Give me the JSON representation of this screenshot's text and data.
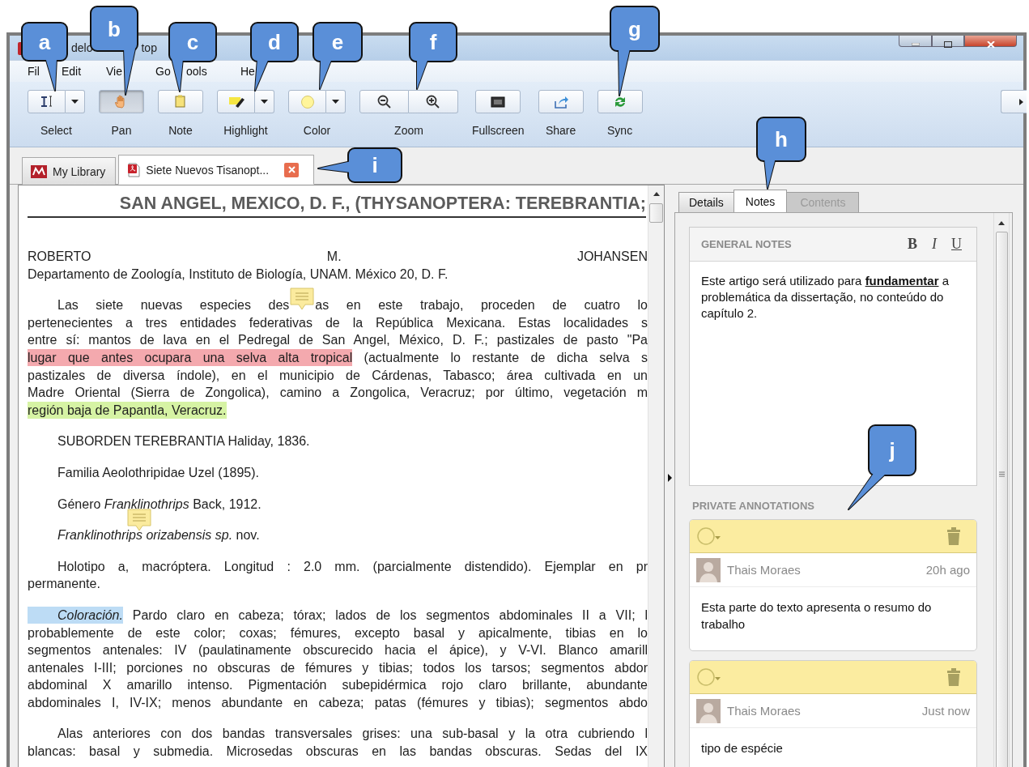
{
  "window": {
    "title_parts": [
      "delo",
      "top"
    ]
  },
  "menu": [
    "Fil",
    "Edit",
    "Vie",
    "Go",
    "ools",
    "He"
  ],
  "toolbar": [
    {
      "kind": "tool",
      "label": "Select",
      "selected": false,
      "dropdown": true
    },
    {
      "kind": "tool",
      "label": "Pan",
      "selected": true,
      "dropdown": false
    },
    {
      "kind": "tool",
      "label": "Note",
      "selected": false,
      "dropdown": false
    },
    {
      "kind": "tool",
      "label": "Highlight",
      "selected": false,
      "dropdown": true
    },
    {
      "kind": "tool",
      "label": "Color",
      "selected": false,
      "dropdown": true
    },
    {
      "kind": "pair",
      "label": "Zoom",
      "selected": false,
      "dropdown": false
    },
    {
      "kind": "tool",
      "label": "Fullscreen",
      "selected": false,
      "dropdown": false
    },
    {
      "kind": "tool",
      "label": "Share",
      "selected": false,
      "dropdown": false
    },
    {
      "kind": "tool",
      "label": "Sync",
      "selected": false,
      "dropdown": false
    }
  ],
  "doc_tabs": [
    {
      "kind": "library",
      "label": "My Library",
      "selected": false,
      "closable": false
    },
    {
      "kind": "pdf",
      "label": "Siete Nuevos Tisanopt...",
      "selected": true,
      "closable": true
    }
  ],
  "document": {
    "heading": "SAN ANGEL, MEXICO, D. F., (THYSANOPTERA: TEREBRANTIA;",
    "paragraphs": [
      {
        "indent": false,
        "continues": false,
        "lines": [
          [
            {
              "kind": "text",
              "text": "ROBERTO M. JOHANSEN"
            }
          ],
          [
            {
              "kind": "text",
              "text": "Departamento de Zoología, Instituto de Biología, UNAM. México 20, D. F."
            }
          ]
        ]
      },
      {
        "indent": true,
        "continues": false,
        "lines": [
          [
            {
              "kind": "text",
              "text": "Las siete nuevas especies des"
            },
            {
              "kind": "note"
            },
            {
              "kind": "text",
              "text": "as en este trabajo, proceden de cuatro lo"
            }
          ],
          [
            {
              "kind": "text",
              "text": "pertenecientes a tres entidades federativas de la República Mexicana. Estas localidades s"
            }
          ],
          [
            {
              "kind": "text",
              "text": "entre sí: mantos de lava en el Pedregal de San Angel, México, D. F.; pastizales de pasto \"Pa"
            }
          ],
          [
            {
              "kind": "text",
              "text": "lugar que antes ocupara una selva alta tropical",
              "color": "#f4a9ae"
            },
            {
              "kind": "text",
              "text": " (actualmente lo restante de dicha selva s"
            }
          ],
          [
            {
              "kind": "text",
              "text": "pastizales de diversa índole), en el municipio de Cárdenas, Tabasco; área cultivada en un"
            }
          ],
          [
            {
              "kind": "text",
              "text": "Madre Oriental (Sierra de Zongolica), camino a Zongolica, Veracruz; por último, vegetación m"
            }
          ],
          [
            {
              "kind": "text",
              "text": "región baja de Papantla, Veracruz.",
              "color": "#d6f3a4"
            }
          ]
        ]
      },
      {
        "indent": true,
        "continues": false,
        "lines": [
          [
            {
              "kind": "text",
              "text": "SUBORDEN TEREBRANTIA Haliday, 1836."
            }
          ]
        ]
      },
      {
        "indent": true,
        "continues": false,
        "lines": [
          [
            {
              "kind": "text",
              "text": "Familia Aeolothripidae Uzel (1895)."
            }
          ]
        ]
      },
      {
        "indent": true,
        "continues": false,
        "lines": [
          [
            {
              "kind": "text",
              "text": "Género *Franklinothrips*"
            },
            {
              "kind": "hanging_note"
            },
            {
              "kind": "text",
              "text": " Back, 1912."
            }
          ]
        ]
      },
      {
        "indent": true,
        "continues": false,
        "lines": [
          [
            {
              "kind": "text",
              "text": "*Franklinothrips orizabensis sp.* nov."
            }
          ]
        ]
      },
      {
        "indent": true,
        "continues": false,
        "lines": [
          [
            {
              "kind": "text",
              "text": "Holotipo a, macróptera. Longitud : 2.0 mm. (parcialmente distendido). Ejemplar en pr"
            }
          ],
          [
            {
              "kind": "text",
              "text": "permanente."
            }
          ]
        ]
      },
      {
        "indent": true,
        "continues": true,
        "lines": [
          [
            {
              "kind": "text",
              "text": "*Coloración.*",
              "color": "#bddcf5"
            },
            {
              "kind": "text",
              "text": " Pardo claro en cabeza; tórax; lados de los segmentos abdominales II a VII; l"
            }
          ],
          [
            {
              "kind": "text",
              "text": "probablemente de este color; coxas; fémures, excepto basal y apicalmente, tibias en lo"
            }
          ],
          [
            {
              "kind": "text",
              "text": "segmentos antenales: IV (paulatinamente obscurecido hacia el ápice), y V-VI. Blanco amarill"
            }
          ],
          [
            {
              "kind": "text",
              "text": "antenales I-III; porciones no obscuras de fémures y tibias; todos los tarsos; segmentos abdor"
            }
          ],
          [
            {
              "kind": "text",
              "text": "abdominal X amarillo intenso. Pigmentación subepidérmica rojo claro brillante, abundante"
            }
          ],
          [
            {
              "kind": "text",
              "text": "abdominales I, IV-IX; menos abundante en cabeza; patas (fémures y tibias); segmentos abdo"
            }
          ]
        ]
      },
      {
        "indent": true,
        "continues": true,
        "lines": [
          [
            {
              "kind": "text",
              "text": "Alas anteriores con dos bandas transversales grises: una sub-basal y la otra cubriendo l"
            }
          ],
          [
            {
              "kind": "text",
              "text": "blancas: basal y submedia. Microsedas obscuras en las bandas obscuras. Sedas del IX"
            }
          ]
        ]
      }
    ]
  },
  "side_panel": {
    "tabs": [
      {
        "label": "Details",
        "selected": false,
        "disabled": false
      },
      {
        "label": "Notes",
        "selected": true,
        "disabled": false
      },
      {
        "label": "Contents",
        "selected": false,
        "disabled": true
      }
    ],
    "general_notes": {
      "title": "GENERAL NOTES",
      "format_buttons": [
        "B",
        "I",
        "U"
      ],
      "text": "Este artigo será utilizado para **fundamentar** a problemática da dissertação, no conteúdo do capítulo 2."
    },
    "annotations": {
      "title": "PRIVATE ANNOTATIONS",
      "items": [
        {
          "author": "Thais Moraes",
          "time": "20h ago",
          "text": "Esta parte do texto apresenta o resumo do trabalho"
        },
        {
          "author": "Thais Moraes",
          "time": "Just now",
          "text": "tipo de espécie"
        }
      ]
    }
  },
  "callouts": [
    "a",
    "b",
    "c",
    "d",
    "e",
    "f",
    "g",
    "h",
    "i",
    "j"
  ]
}
